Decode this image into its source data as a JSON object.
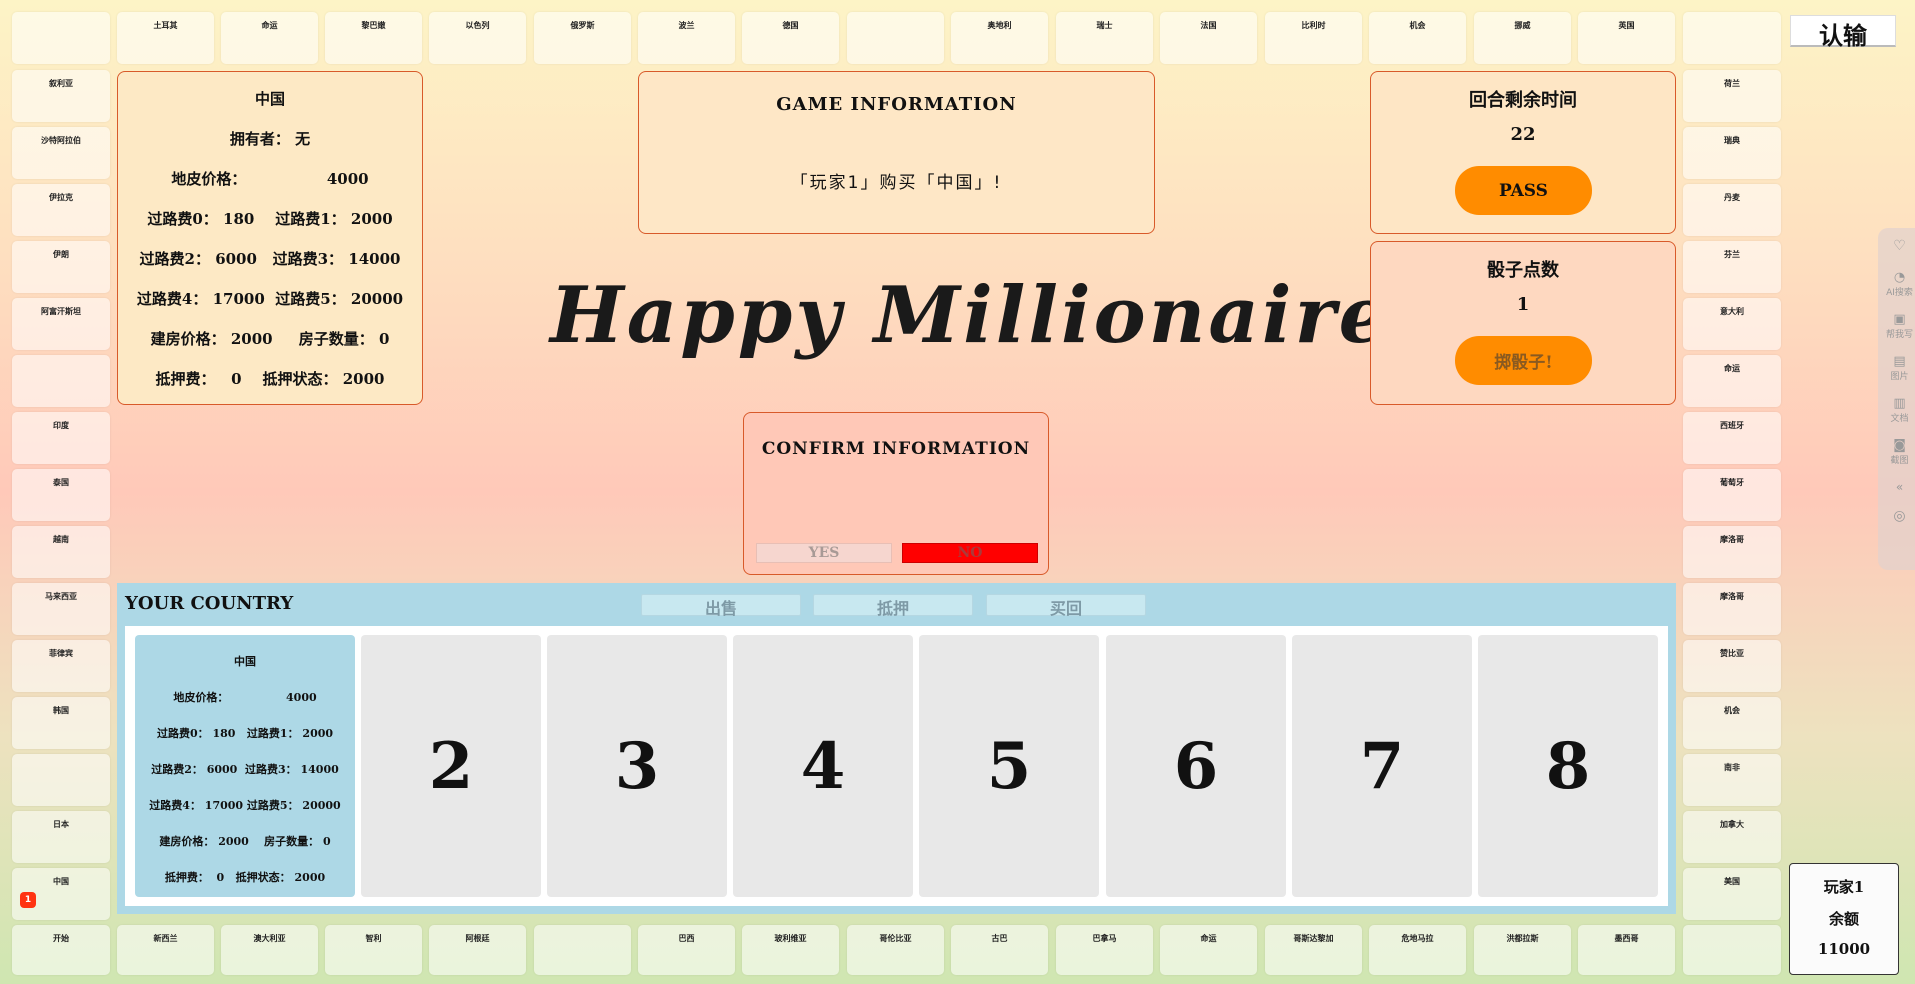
{
  "board": {
    "top_row": [
      "土耳其",
      "命运",
      "黎巴嫩",
      "以色列",
      "俄罗斯",
      "波兰",
      "德国",
      "",
      "奥地利",
      "瑞士",
      "法国",
      "比利时",
      "机会",
      "挪威",
      "英国",
      ""
    ],
    "left_col": [
      "叙利亚",
      "沙特阿拉伯",
      "伊拉克",
      "伊朗",
      "阿富汗斯坦",
      "",
      "印度",
      "泰国",
      "越南",
      "马来西亚",
      "菲律宾",
      "韩国",
      "",
      "日本",
      "中国"
    ],
    "right_col": [
      "荷兰",
      "瑞典",
      "丹麦",
      "芬兰",
      "意大利",
      "命运",
      "西班牙",
      "葡萄牙",
      "摩洛哥",
      "摩洛哥",
      "赞比亚",
      "机会",
      "南非",
      "加拿大",
      "美国"
    ],
    "bottom_row": [
      "开始",
      "新西兰",
      "澳大利亚",
      "智利",
      "阿根廷",
      "",
      "巴西",
      "玻利维亚",
      "哥伦比亚",
      "古巴",
      "巴拿马",
      "命运",
      "哥斯达黎加",
      "危地马拉",
      "洪都拉斯",
      "墨西哥",
      ""
    ],
    "player_marker": "1"
  },
  "surrender_button": "认输",
  "property_panel": {
    "name": "中国",
    "owner_label": "拥有者：",
    "owner_value": "无",
    "land_price_label": "地皮价格：",
    "land_price_value": "4000",
    "toll0_label": "过路费0：",
    "toll0_value": "180",
    "toll1_label": "过路费1：",
    "toll1_value": "2000",
    "toll2_label": "过路费2：",
    "toll2_value": "6000",
    "toll3_label": "过路费3：",
    "toll3_value": "14000",
    "toll4_label": "过路费4：",
    "toll4_value": "17000",
    "toll5_label": "过路费5：",
    "toll5_value": "20000",
    "house_price_label": "建房价格：",
    "house_price_value": "2000",
    "house_count_label": "房子数量：",
    "house_count_value": "0",
    "mortgage_fee_label": "抵押费：",
    "mortgage_fee_value": "0",
    "mortgage_status_label": "抵押状态：",
    "mortgage_status_value": "2000"
  },
  "game_info": {
    "title": "GAME INFORMATION",
    "message": "「玩家1」购买「中国」!"
  },
  "game_title": "Happy Millionaire",
  "confirm": {
    "title": "CONFIRM INFORMATION",
    "yes": "YES",
    "no": "NO"
  },
  "timer": {
    "label": "回合剩余时间",
    "value": "22",
    "pass": "PASS"
  },
  "dice": {
    "label": "骰子点数",
    "value": "1",
    "roll": "掷骰子!"
  },
  "your_country": {
    "title": "YOUR COUNTRY",
    "sell": "出售",
    "mortgage": "抵押",
    "redeem": "买回",
    "card": {
      "name": "中国",
      "land_price_label": "地皮价格：",
      "land_price_value": "4000",
      "toll0_label": "过路费0：",
      "toll0_value": "180",
      "toll1_label": "过路费1：",
      "toll1_value": "2000",
      "toll2_label": "过路费2：",
      "toll2_value": "6000",
      "toll3_label": "过路费3：",
      "toll3_value": "14000",
      "toll4_label": "过路费4：",
      "toll4_value": "17000",
      "toll5_label": "过路费5：",
      "toll5_value": "20000",
      "house_price_label": "建房价格：",
      "house_price_value": "2000",
      "house_count_label": "房子数量：",
      "house_count_value": "0",
      "mortgage_fee_label": "抵押费：",
      "mortgage_fee_value": "0",
      "mortgage_status_label": "抵押状态：",
      "mortgage_status_value": "2000"
    },
    "slots": [
      "2",
      "3",
      "4",
      "5",
      "6",
      "7",
      "8"
    ]
  },
  "player": {
    "name": "玩家1",
    "balance_label": "余额",
    "balance": "11000"
  },
  "toolbar": {
    "ai_search": "AI搜索",
    "help": "帮我写",
    "image": "图片",
    "doc": "文档",
    "screenshot": "截图"
  },
  "colors": {
    "accent_orange": "#ff8c00",
    "panel_border": "#d85a2a",
    "no_red": "#ff0000",
    "country_blue": "#add8e6"
  }
}
